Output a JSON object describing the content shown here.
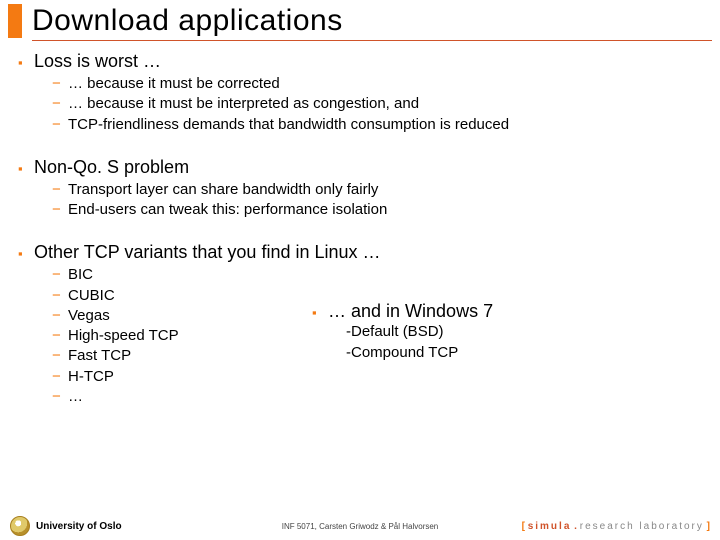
{
  "title": "Download applications",
  "sections": [
    {
      "head": "Loss is worst …",
      "items": [
        "… because it must be corrected",
        "… because it must be interpreted as congestion, and",
        "TCP-friendliness demands that bandwidth consumption is reduced"
      ]
    },
    {
      "head": "Non-Qo. S problem",
      "items": [
        "Transport layer can share bandwidth only fairly",
        "End-users can tweak this: performance isolation"
      ]
    }
  ],
  "linux": {
    "head": "Other TCP variants that you find in Linux …",
    "items": [
      "BIC",
      "CUBIC",
      "Vegas",
      "High-speed TCP",
      "Fast TCP",
      "H-TCP",
      "…"
    ]
  },
  "windows": {
    "head": "… and in Windows 7",
    "items": [
      "-Default (BSD)",
      "-Compound TCP"
    ]
  },
  "footer": {
    "left": "University of Oslo",
    "center": "INF 5071, Carsten Griwodz & Pål Halvorsen",
    "right_open": "[ ",
    "right_sim": "simula",
    "right_dot": " . ",
    "right_lab": "research laboratory",
    "right_close": " ]"
  }
}
